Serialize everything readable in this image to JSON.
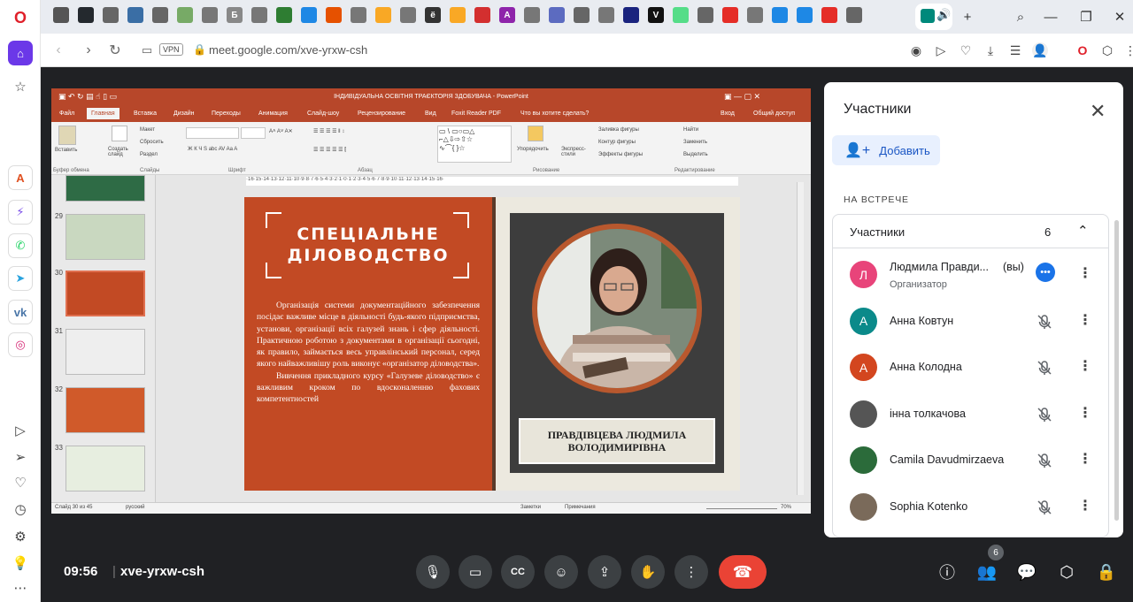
{
  "browser": {
    "url": "meet.google.com/xve-yrxw-csh",
    "vpn": "VPN",
    "tabs": [
      {
        "icon": "tab-favicon",
        "color": "#555"
      },
      {
        "icon": "github-icon",
        "color": "#24292e"
      },
      {
        "icon": "doc-icon",
        "color": "#666"
      },
      {
        "icon": "doc-icon",
        "color": "#3a6ea5"
      },
      {
        "icon": "doc-icon",
        "color": "#666"
      },
      {
        "icon": "doc-icon",
        "color": "#7a6"
      },
      {
        "icon": "doc-icon",
        "color": "#777"
      },
      {
        "icon": "b-icon",
        "color": "#888",
        "letter": "Б"
      },
      {
        "icon": "doc-icon",
        "color": "#777"
      },
      {
        "icon": "books-icon",
        "color": "#2e7d32"
      },
      {
        "icon": "wave-icon",
        "color": "#1e88e5"
      },
      {
        "icon": "face-icon",
        "color": "#e65100"
      },
      {
        "icon": "doc-icon",
        "color": "#777"
      },
      {
        "icon": "g-icon",
        "color": "#f9a825"
      },
      {
        "icon": "doc-icon",
        "color": "#777"
      },
      {
        "icon": "e-icon",
        "color": "#333",
        "letter": "ё"
      },
      {
        "icon": "globe-icon",
        "color": "#f9a825"
      },
      {
        "icon": "mail-icon",
        "color": "#d32f2f"
      },
      {
        "icon": "a-icon",
        "color": "#8e24aa",
        "letter": "A"
      },
      {
        "icon": "doc-icon",
        "color": "#777"
      },
      {
        "icon": "grid-icon",
        "color": "#5c6bc0"
      },
      {
        "icon": "fx-icon",
        "color": "#666"
      },
      {
        "icon": "doc-icon",
        "color": "#777"
      },
      {
        "icon": "eu-icon",
        "color": "#1a237e"
      },
      {
        "icon": "v-icon",
        "color": "#111",
        "letter": "V"
      },
      {
        "icon": "books-icon",
        "color": "#5d8"
      },
      {
        "icon": "bank-icon",
        "color": "#666"
      },
      {
        "icon": "youtube-icon",
        "color": "#e52d27"
      },
      {
        "icon": "bug-icon",
        "color": "#777"
      },
      {
        "icon": "puzzle-icon",
        "color": "#1e88e5"
      },
      {
        "icon": "star-icon",
        "color": "#1e88e5"
      },
      {
        "icon": "youtube-icon",
        "color": "#e52d27"
      },
      {
        "icon": "bank-icon",
        "color": "#666"
      }
    ]
  },
  "opera_sidebar": {
    "items": [
      "opera-logo-icon",
      "home-icon",
      "bookmark-icon",
      "aria-icon",
      "messenger-icon",
      "whatsapp-icon",
      "telegram-icon",
      "vk-icon",
      "instagram-icon",
      "player-icon",
      "send-icon",
      "heart-icon",
      "history-icon",
      "settings-icon",
      "bulb-icon",
      "more-icon"
    ]
  },
  "powerpoint": {
    "title": "ІНДИВІДУАЛЬНА ОСВІТНЯ ТРАЄКТОРІЯ ЗДОБУВАЧА - PowerPoint",
    "menu": [
      "Файл",
      "Главная",
      "Вставка",
      "Дизайн",
      "Переходы",
      "Анимация",
      "Слайд-шоу",
      "Рецензирование",
      "Вид",
      "Foxit Reader PDF",
      "Что вы хотите сделать?",
      "Вход",
      "Общий доступ"
    ],
    "ribbon": {
      "paste": "Вставить",
      "clipboard": "Буфер обмена",
      "create_slide": "Создать слайд",
      "layout": "Макет",
      "reset": "Сбросить",
      "section": "Раздел",
      "slides": "Слайды",
      "font": "Шрифт",
      "paragraph": "Абзац",
      "arrange": "Упорядочить",
      "quick_styles": "Экспресс-стили",
      "fill": "Заливка фигуры",
      "outline": "Контур фигуры",
      "effects": "Эффекты фигуры",
      "drawing": "Рисование",
      "find": "Найти",
      "replace": "Заменить",
      "select": "Выделить",
      "editing": "Редактирование"
    },
    "ruler": "·16·15·14·13·12·11·10·9·8·7·6·5·4·3·2·1·0·1·2·3·4·5·6·7·8·9·10·11·12·13·14·15·16·",
    "thumb_numbers": [
      "29",
      "30",
      "31",
      "32",
      "33"
    ],
    "status": {
      "slide": "Слайд 30 из 45",
      "lang": "русский",
      "notes": "Заметки",
      "comments": "Примечания",
      "zoom": "70%"
    }
  },
  "slide": {
    "heading": "СПЕЦІАЛЬНЕ ДІЛОВОДСТВО",
    "paragraph1": "Організація системи документаційного забезпечення посідає важливе місце в діяльності будь-якого підприємства, установи, організації всіх галузей знань і сфер діяльності. Практичною роботою з документами в організації сьогодні, як правило, займається весь управлінський персонал, серед якого найважливішу роль виконує «організатор діловодства».",
    "paragraph2": "Вивчення прикладного курсу «Галузеве діловодство» є важливим кроком по вдосконаленню фахових компетентностей",
    "name": "ПРАВДІВЦЕВА ЛЮДМИЛА ВОЛОДИМИРІВНА"
  },
  "panel": {
    "title": "Участники",
    "add": "Добавить",
    "section": "НА ВСТРЕЧЕ",
    "group_label": "Участники",
    "count": "6",
    "participants": [
      {
        "name": "Людмила Правди...",
        "suffix": "(вы)",
        "role": "Организатор",
        "initial": "Л",
        "color": "#e8447a"
      },
      {
        "name": "Анна Ковтун",
        "initial": "А",
        "color": "#0b8a8a"
      },
      {
        "name": "Анна Колодна",
        "initial": "А",
        "color": "#d3461f"
      },
      {
        "name": "інна толкачова",
        "initial": "",
        "color": "#555"
      },
      {
        "name": "Camila Davudmirzaeva",
        "initial": "",
        "color": "#2b6b3a"
      },
      {
        "name": "Sophia Kotenko",
        "initial": "",
        "color": "#7a6a5a"
      }
    ]
  },
  "bottombar": {
    "time": "09:56",
    "separator": "|",
    "code": "xve-yrxw-csh",
    "people_count": "6"
  }
}
